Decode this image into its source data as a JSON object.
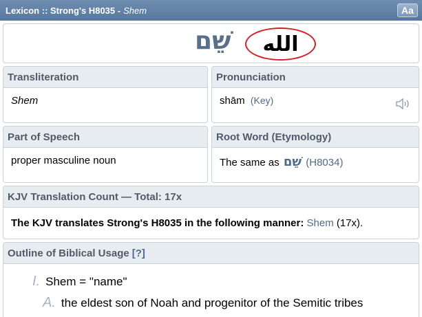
{
  "titlebar": {
    "label": "Lexicon :: Strong's H8035 - ",
    "shem": "Shem",
    "aa_label": "Aa"
  },
  "lemma": {
    "hebrew": "שֵׁם",
    "annotation": "الله",
    "annotation_color": "#d21f2a"
  },
  "transliteration": {
    "heading": "Transliteration",
    "value": "Shem"
  },
  "pronunciation": {
    "heading": "Pronunciation",
    "value": "shām",
    "key_link": "(Key)",
    "icon": "speaker-icon"
  },
  "part_of_speech": {
    "heading": "Part of Speech",
    "value": "proper masculine noun"
  },
  "root_word": {
    "heading": "Root Word (Etymology)",
    "prefix": "The same as",
    "hebrew": "שֵׁם",
    "ref": "(H8034)"
  },
  "kjv": {
    "heading": "KJV Translation Count — Total: 17x",
    "statement": "The KJV translates Strong's H8035 in the following manner:",
    "word": "Shem",
    "count": "(17x)."
  },
  "outline": {
    "heading": "Outline of Biblical Usage",
    "help": "[?]",
    "items": [
      {
        "marker": "I.",
        "text": "Shem = \"name\""
      },
      {
        "marker": "A.",
        "text": "the eldest son of Noah and progenitor of the Semitic tribes"
      }
    ]
  },
  "colors": {
    "titlebar": "#56779e",
    "heading_bg": "#e7ecf1",
    "link": "#4f6a8e",
    "annotation_red": "#d21f2a"
  }
}
